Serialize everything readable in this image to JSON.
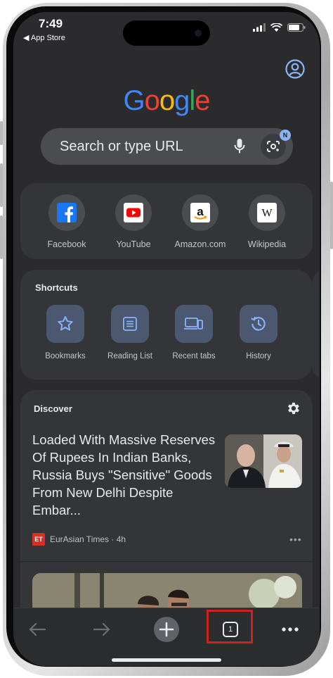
{
  "status_bar": {
    "time": "7:49",
    "back_link": "◀ App Store"
  },
  "logo": {
    "letters": [
      "G",
      "o",
      "o",
      "g",
      "l",
      "e"
    ],
    "colors": [
      "#4285F4",
      "#EA4335",
      "#FBBC05",
      "#4285F4",
      "#34A853",
      "#EA4335"
    ]
  },
  "search": {
    "placeholder": "Search or type URL",
    "lens_badge": "N"
  },
  "most_visited": [
    {
      "label": "Facebook",
      "icon": "facebook-icon"
    },
    {
      "label": "YouTube",
      "icon": "youtube-icon"
    },
    {
      "label": "Amazon.com",
      "icon": "amazon-icon"
    },
    {
      "label": "Wikipedia",
      "icon": "wikipedia-icon"
    }
  ],
  "shortcuts": {
    "title": "Shortcuts",
    "items": [
      {
        "label": "Bookmarks",
        "icon": "star-icon"
      },
      {
        "label": "Reading List",
        "icon": "reading-list-icon"
      },
      {
        "label": "Recent tabs",
        "icon": "recent-tabs-icon"
      },
      {
        "label": "History",
        "icon": "history-icon"
      }
    ]
  },
  "discover": {
    "title": "Discover",
    "article": {
      "title": "Loaded With Massive Reserves Of Rupees In Indian Banks, Russia Buys \"Sensitive\" Goods From New Delhi Despite Embar...",
      "source_logo": "ET",
      "source": "EurAsian Times · 4h",
      "menu": "•••"
    }
  },
  "toolbar": {
    "tab_count": "1",
    "more": "•••"
  },
  "colors": {
    "screen_bg": "#2b2b2d",
    "card_bg": "#343538",
    "accent": "#8ab4f8",
    "highlight": "#d0211c"
  }
}
